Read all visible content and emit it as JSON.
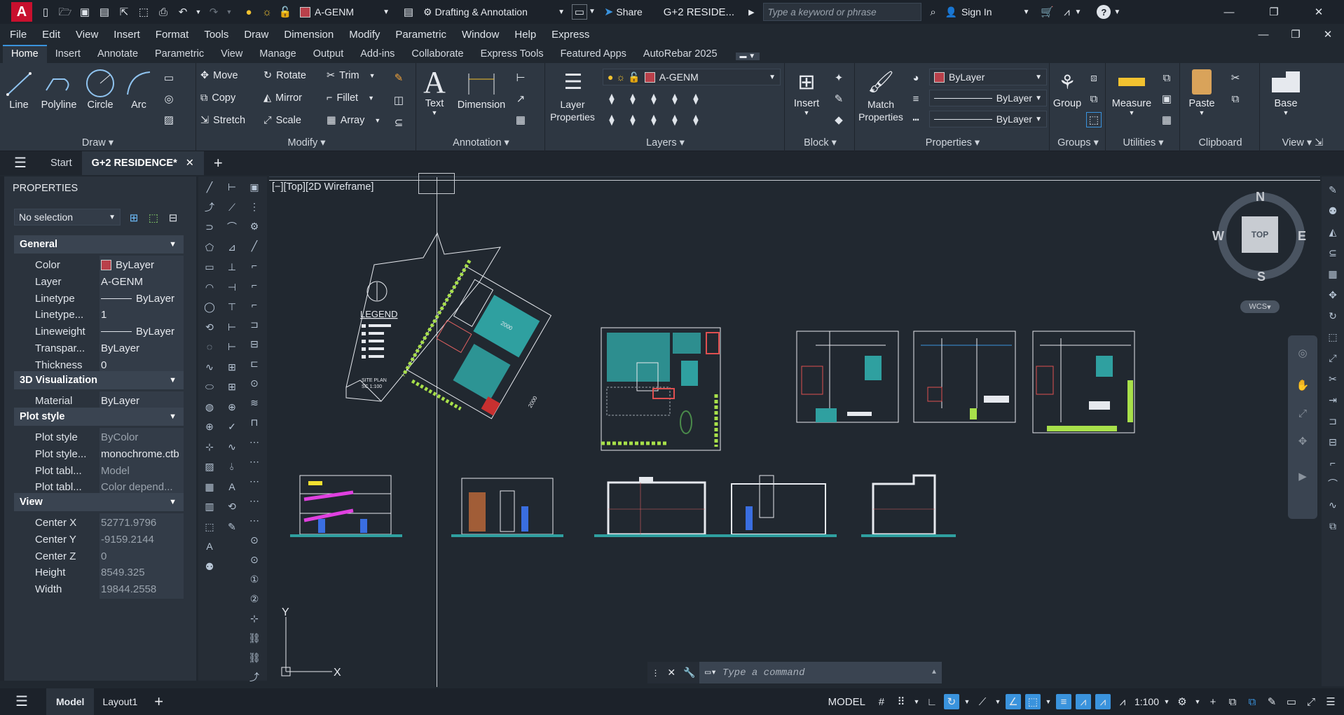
{
  "app": {
    "logo_letter": "A",
    "workspace": "Drafting & Annotation",
    "share": "Share",
    "file_title": "G+2 RESIDE...",
    "search_placeholder": "Type a keyword or phrase",
    "sign_in": "Sign In",
    "qa_layer": "A-GENM",
    "help": "?"
  },
  "menu": [
    "File",
    "Edit",
    "View",
    "Insert",
    "Format",
    "Tools",
    "Draw",
    "Dimension",
    "Modify",
    "Parametric",
    "Window",
    "Help",
    "Express"
  ],
  "ribbon_tabs": [
    "Home",
    "Insert",
    "Annotate",
    "Parametric",
    "View",
    "Manage",
    "Output",
    "Add-ins",
    "Collaborate",
    "Express Tools",
    "Featured Apps",
    "AutoRebar 2025"
  ],
  "ribbon": {
    "draw": {
      "title": "Draw",
      "line": "Line",
      "polyline": "Polyline",
      "circle": "Circle",
      "arc": "Arc"
    },
    "modify": {
      "title": "Modify",
      "move": "Move",
      "rotate": "Rotate",
      "trim": "Trim",
      "copy": "Copy",
      "mirror": "Mirror",
      "fillet": "Fillet",
      "stretch": "Stretch",
      "scale": "Scale",
      "array": "Array"
    },
    "annotation": {
      "title": "Annotation",
      "text": "Text",
      "dimension": "Dimension"
    },
    "layers": {
      "title": "Layers",
      "layer_properties": "Layer Properties",
      "current_layer": "A-GENM"
    },
    "block": {
      "title": "Block",
      "insert": "Insert"
    },
    "properties": {
      "title": "Properties",
      "match": "Match Properties",
      "color": "ByLayer",
      "linetype": "ByLayer",
      "lineweight": "ByLayer"
    },
    "groups": {
      "title": "Groups",
      "group": "Group"
    },
    "utilities": {
      "title": "Utilities",
      "measure": "Measure"
    },
    "clipboard": {
      "title": "Clipboard",
      "paste": "Paste"
    },
    "view": {
      "title": "View",
      "base": "Base"
    }
  },
  "doc_tabs": {
    "start": "Start",
    "current": "G+2 RESIDENCE*"
  },
  "properties_panel": {
    "title": "PROPERTIES",
    "selection": "No selection",
    "general": {
      "header": "General",
      "rows": [
        [
          "Color",
          "ByLayer"
        ],
        [
          "Layer",
          "A-GENM"
        ],
        [
          "Linetype",
          "ByLayer"
        ],
        [
          "Linetype...",
          "1"
        ],
        [
          "Lineweight",
          "ByLayer"
        ],
        [
          "Transpar...",
          "ByLayer"
        ],
        [
          "Thickness",
          "0"
        ]
      ]
    },
    "viz": {
      "header": "3D Visualization",
      "rows": [
        [
          "Material",
          "ByLayer"
        ]
      ]
    },
    "plot": {
      "header": "Plot style",
      "rows": [
        [
          "Plot style",
          "ByColor"
        ],
        [
          "Plot style...",
          "monochrome.ctb"
        ],
        [
          "Plot tabl...",
          "Model"
        ],
        [
          "Plot tabl...",
          "Color depend..."
        ]
      ]
    },
    "view": {
      "header": "View",
      "rows": [
        [
          "Center X",
          "52771.9796"
        ],
        [
          "Center Y",
          "-9159.2144"
        ],
        [
          "Center Z",
          "0"
        ],
        [
          "Height",
          "8549.325"
        ],
        [
          "Width",
          "19844.2558"
        ]
      ]
    }
  },
  "viewport": {
    "label": "[−][Top][2D Wireframe]",
    "compass": {
      "n": "N",
      "s": "S",
      "e": "E",
      "w": "W",
      "top": "TOP"
    },
    "wcs": "WCS",
    "legend_title": "LEGEND",
    "site_plan_line1": "SITE PLAN",
    "site_plan_line2": "SC 1:100",
    "dim1": "2000",
    "dim2": "2000",
    "ucs_x": "X",
    "ucs_y": "Y"
  },
  "command": {
    "placeholder": "Type a command"
  },
  "layout_tabs": {
    "model": "Model",
    "layout1": "Layout1"
  },
  "status": {
    "model": "MODEL",
    "scale": "1:100"
  },
  "colors": {
    "accent": "#3a93dd",
    "teal": "#2fa0a0",
    "green": "#a8e04a",
    "magenta": "#e040e0"
  }
}
